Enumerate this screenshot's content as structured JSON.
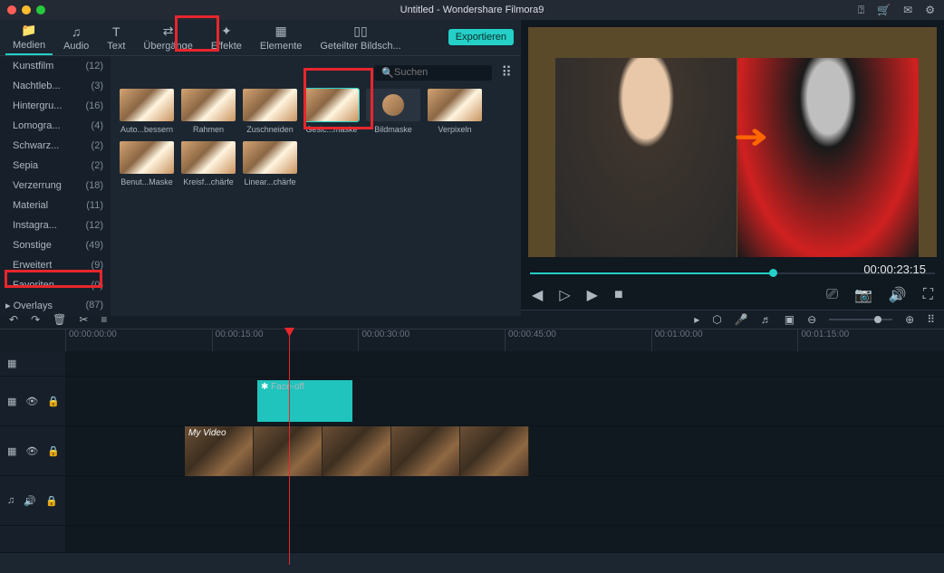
{
  "title": "Untitled - Wondershare Filmora9",
  "titleicons": [
    "user",
    "cart",
    "mail",
    "settings"
  ],
  "tabs": [
    {
      "icon": "folder",
      "label": "Medien",
      "active": true
    },
    {
      "icon": "note",
      "label": "Audio"
    },
    {
      "icon": "T",
      "label": "Text"
    },
    {
      "icon": "trans",
      "label": "Übergänge"
    },
    {
      "icon": "fx",
      "label": "Effekte"
    },
    {
      "icon": "elem",
      "label": "Elemente"
    },
    {
      "icon": "split",
      "label": "Geteilter Bildsch..."
    }
  ],
  "export": "Exportieren",
  "search_placeholder": "Suchen",
  "sidebar": [
    {
      "name": "Kunstfilm",
      "count": "(12)"
    },
    {
      "name": "Nachtleb...",
      "count": "(3)"
    },
    {
      "name": "Hintergru...",
      "count": "(16)"
    },
    {
      "name": "Lomogra...",
      "count": "(4)"
    },
    {
      "name": "Schwarz...",
      "count": "(2)"
    },
    {
      "name": "Sepia",
      "count": "(2)"
    },
    {
      "name": "Verzerrung",
      "count": "(18)"
    },
    {
      "name": "Material",
      "count": "(11)"
    },
    {
      "name": "Instagra...",
      "count": "(12)"
    },
    {
      "name": "Sonstige",
      "count": "(49)"
    },
    {
      "name": "Erweitert",
      "count": "(9)"
    },
    {
      "name": "Favoriten",
      "count": "(0)"
    }
  ],
  "overlays": {
    "label": "Overlays",
    "count": "(87)"
  },
  "thumbs": [
    {
      "label": "Auto...bessern"
    },
    {
      "label": "Rahmen"
    },
    {
      "label": "Zuschneiden"
    },
    {
      "label": "Gesic...maske",
      "selected": true
    },
    {
      "label": "Bildmaske",
      "circle": true
    },
    {
      "label": "Verpixeln"
    },
    {
      "label": "Benut...Maske"
    },
    {
      "label": "Kreisf...chärfe"
    },
    {
      "label": "Linear...chärfe"
    }
  ],
  "timecode": "00:00:23:15",
  "ruler": [
    "00:00:00:00",
    "00:00:15:00",
    "00:00:30:00",
    "00:00:45:00",
    "00:01:00:00",
    "00:01:15:00"
  ],
  "clip_fx": "Face-off",
  "clip_vid": "My Video"
}
